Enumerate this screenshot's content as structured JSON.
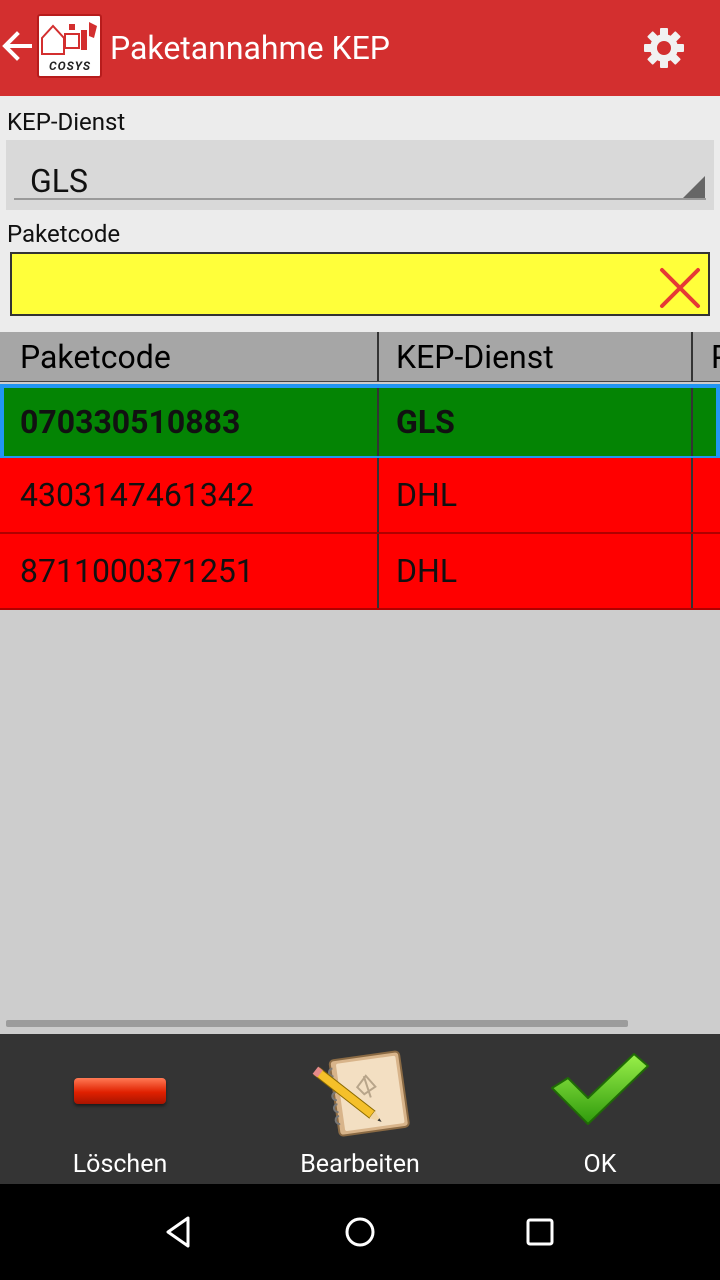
{
  "colors": {
    "app_bar": "#d32f2f",
    "input_highlight": "#ffff3a",
    "row_ok": "#048404",
    "row_error": "#ff0000",
    "selection_border": "#2196f3",
    "action_bar": "#343434"
  },
  "app_bar": {
    "title": "Paketannahme KEP",
    "logo_text": "COSYS",
    "back_icon": "arrow-left-icon",
    "settings_icon": "gear-icon"
  },
  "form": {
    "kep_label": "KEP-Dienst",
    "kep_value": "GLS",
    "code_label": "Paketcode",
    "code_value": "",
    "clear_icon": "close-x-icon"
  },
  "table": {
    "columns": [
      "Paketcode",
      "KEP-Dienst",
      "P"
    ],
    "rows": [
      {
        "code": "070330510883",
        "service": "GLS",
        "status": "ok",
        "selected": true
      },
      {
        "code": "4303147461342",
        "service": "DHL",
        "status": "error",
        "selected": false
      },
      {
        "code": "8711000371251",
        "service": "DHL",
        "status": "error",
        "selected": false
      }
    ]
  },
  "actions": {
    "delete": {
      "label": "Löschen",
      "icon": "minus-icon"
    },
    "edit": {
      "label": "Bearbeiten",
      "icon": "notebook-pencil-icon"
    },
    "ok": {
      "label": "OK",
      "icon": "checkmark-icon"
    }
  },
  "navigation": {
    "back": "nav-back-icon",
    "home": "nav-home-icon",
    "recents": "nav-recents-icon"
  }
}
